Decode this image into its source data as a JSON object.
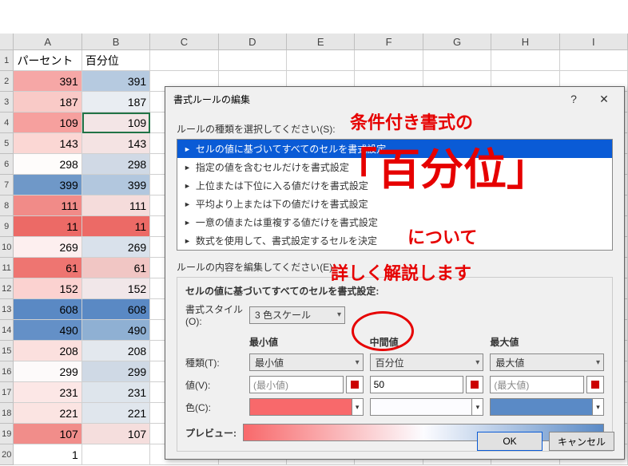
{
  "cols": [
    "A",
    "B",
    "C",
    "D",
    "E",
    "F",
    "G",
    "H",
    "I"
  ],
  "header_row": {
    "a": "パーセント",
    "b": "百分位"
  },
  "rows": [
    {
      "n": 2,
      "a": 391,
      "b": 391,
      "ca": "#f6a7a6",
      "cb": "#b6cae0"
    },
    {
      "n": 3,
      "a": 187,
      "b": 187,
      "ca": "#f9cac7",
      "cb": "#e9edf2"
    },
    {
      "n": 4,
      "a": 109,
      "b": 109,
      "ca": "#f6a09e",
      "cb": "#f3e5e6",
      "sel": true
    },
    {
      "n": 5,
      "a": 143,
      "b": 143,
      "ca": "#fbd7d4",
      "cb": "#f4e3e3"
    },
    {
      "n": 6,
      "a": 298,
      "b": 298,
      "ca": "#fefcfb",
      "cb": "#d0d9e5"
    },
    {
      "n": 7,
      "a": 399,
      "b": 399,
      "ca": "#6f98c8",
      "cb": "#b2c7de"
    },
    {
      "n": 8,
      "a": 111,
      "b": 111,
      "ca": "#f18b88",
      "cb": "#f5dcdb"
    },
    {
      "n": 9,
      "a": 11,
      "b": 11,
      "ca": "#ec6a66",
      "cb": "#ec6a66"
    },
    {
      "n": 10,
      "a": 269,
      "b": 269,
      "ca": "#fdefef",
      "cb": "#d9e1eb"
    },
    {
      "n": 11,
      "a": 61,
      "b": 61,
      "ca": "#ee7571",
      "cb": "#f1c6c4"
    },
    {
      "n": 12,
      "a": 152,
      "b": 152,
      "ca": "#fbd2d0",
      "cb": "#f1e7e9"
    },
    {
      "n": 13,
      "a": 608,
      "b": 608,
      "ca": "#5a89c4",
      "cb": "#5a89c4"
    },
    {
      "n": 14,
      "a": 490,
      "b": 490,
      "ca": "#6490c7",
      "cb": "#8fb0d3"
    },
    {
      "n": 15,
      "a": 208,
      "b": 208,
      "ca": "#fbe0de",
      "cb": "#e3e8ee"
    },
    {
      "n": 16,
      "a": 299,
      "b": 299,
      "ca": "#fdfafa",
      "cb": "#cfd9e5"
    },
    {
      "n": 17,
      "a": 231,
      "b": 231,
      "ca": "#fce7e6",
      "cb": "#dee5ec"
    },
    {
      "n": 18,
      "a": 221,
      "b": 221,
      "ca": "#fbe4e2",
      "cb": "#e0e6ed"
    },
    {
      "n": 19,
      "a": 107,
      "b": 107,
      "ca": "#f18d8a",
      "cb": "#f5dedd"
    },
    {
      "n": 20,
      "a": 1,
      "b": "",
      "ca": "#fff",
      "cb": "#fff"
    }
  ],
  "dialog": {
    "title": "書式ルールの編集",
    "help_icon": "?",
    "close_icon": "✕",
    "rule_type_label": "ルールの種類を選択してください(S):",
    "rule_types": [
      "セルの値に基づいてすべてのセルを書式設定",
      "指定の値を含むセルだけを書式設定",
      "上位または下位に入る値だけを書式設定",
      "平均より上または下の値だけを書式設定",
      "一意の値または重複する値だけを書式設定",
      "数式を使用して、書式設定するセルを決定"
    ],
    "rule_desc_label": "ルールの内容を編集してください(E):",
    "fieldset_title": "セルの値に基づいてすべてのセルを書式設定:",
    "style_label": "書式スタイル(O):",
    "style_value": "3 色スケール",
    "col_headers": {
      "min": "最小値",
      "mid": "中間値",
      "max": "最大値"
    },
    "row_labels": {
      "type": "種類(T):",
      "value": "値(V):",
      "color": "色(C):"
    },
    "types": {
      "min": "最小値",
      "mid": "百分位",
      "max": "最大値"
    },
    "values": {
      "min": "(最小値)",
      "mid": "50",
      "max": "(最大値)"
    },
    "colors": {
      "min": "#f8696b",
      "mid": "#fcfcff",
      "max": "#5a8ac6"
    },
    "preview_label": "プレビュー:",
    "ok": "OK",
    "cancel": "キャンセル"
  },
  "annotation": {
    "line1": "条件付き書式の",
    "line2": "「百分位」",
    "line3": "について",
    "line4": "詳しく解説します"
  }
}
